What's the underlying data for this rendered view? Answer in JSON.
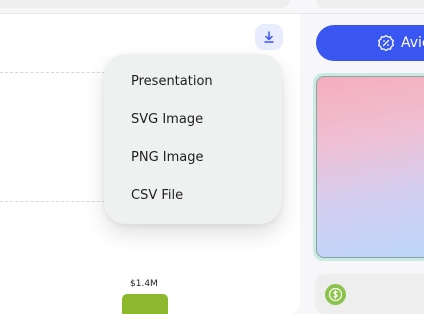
{
  "export_menu": {
    "items": [
      {
        "label": "Presentation"
      },
      {
        "label": "SVG Image"
      },
      {
        "label": "PNG Image"
      },
      {
        "label": "CSV File"
      }
    ]
  },
  "chart": {
    "visible_bar_label": "$1.4M",
    "bar_color": "#8bb82c"
  },
  "cta": {
    "label": "Avic",
    "color": "#3a56f0"
  },
  "icons": {
    "download": "download-icon",
    "cta": "badge-icon",
    "coin": "dollar-coin-icon"
  }
}
